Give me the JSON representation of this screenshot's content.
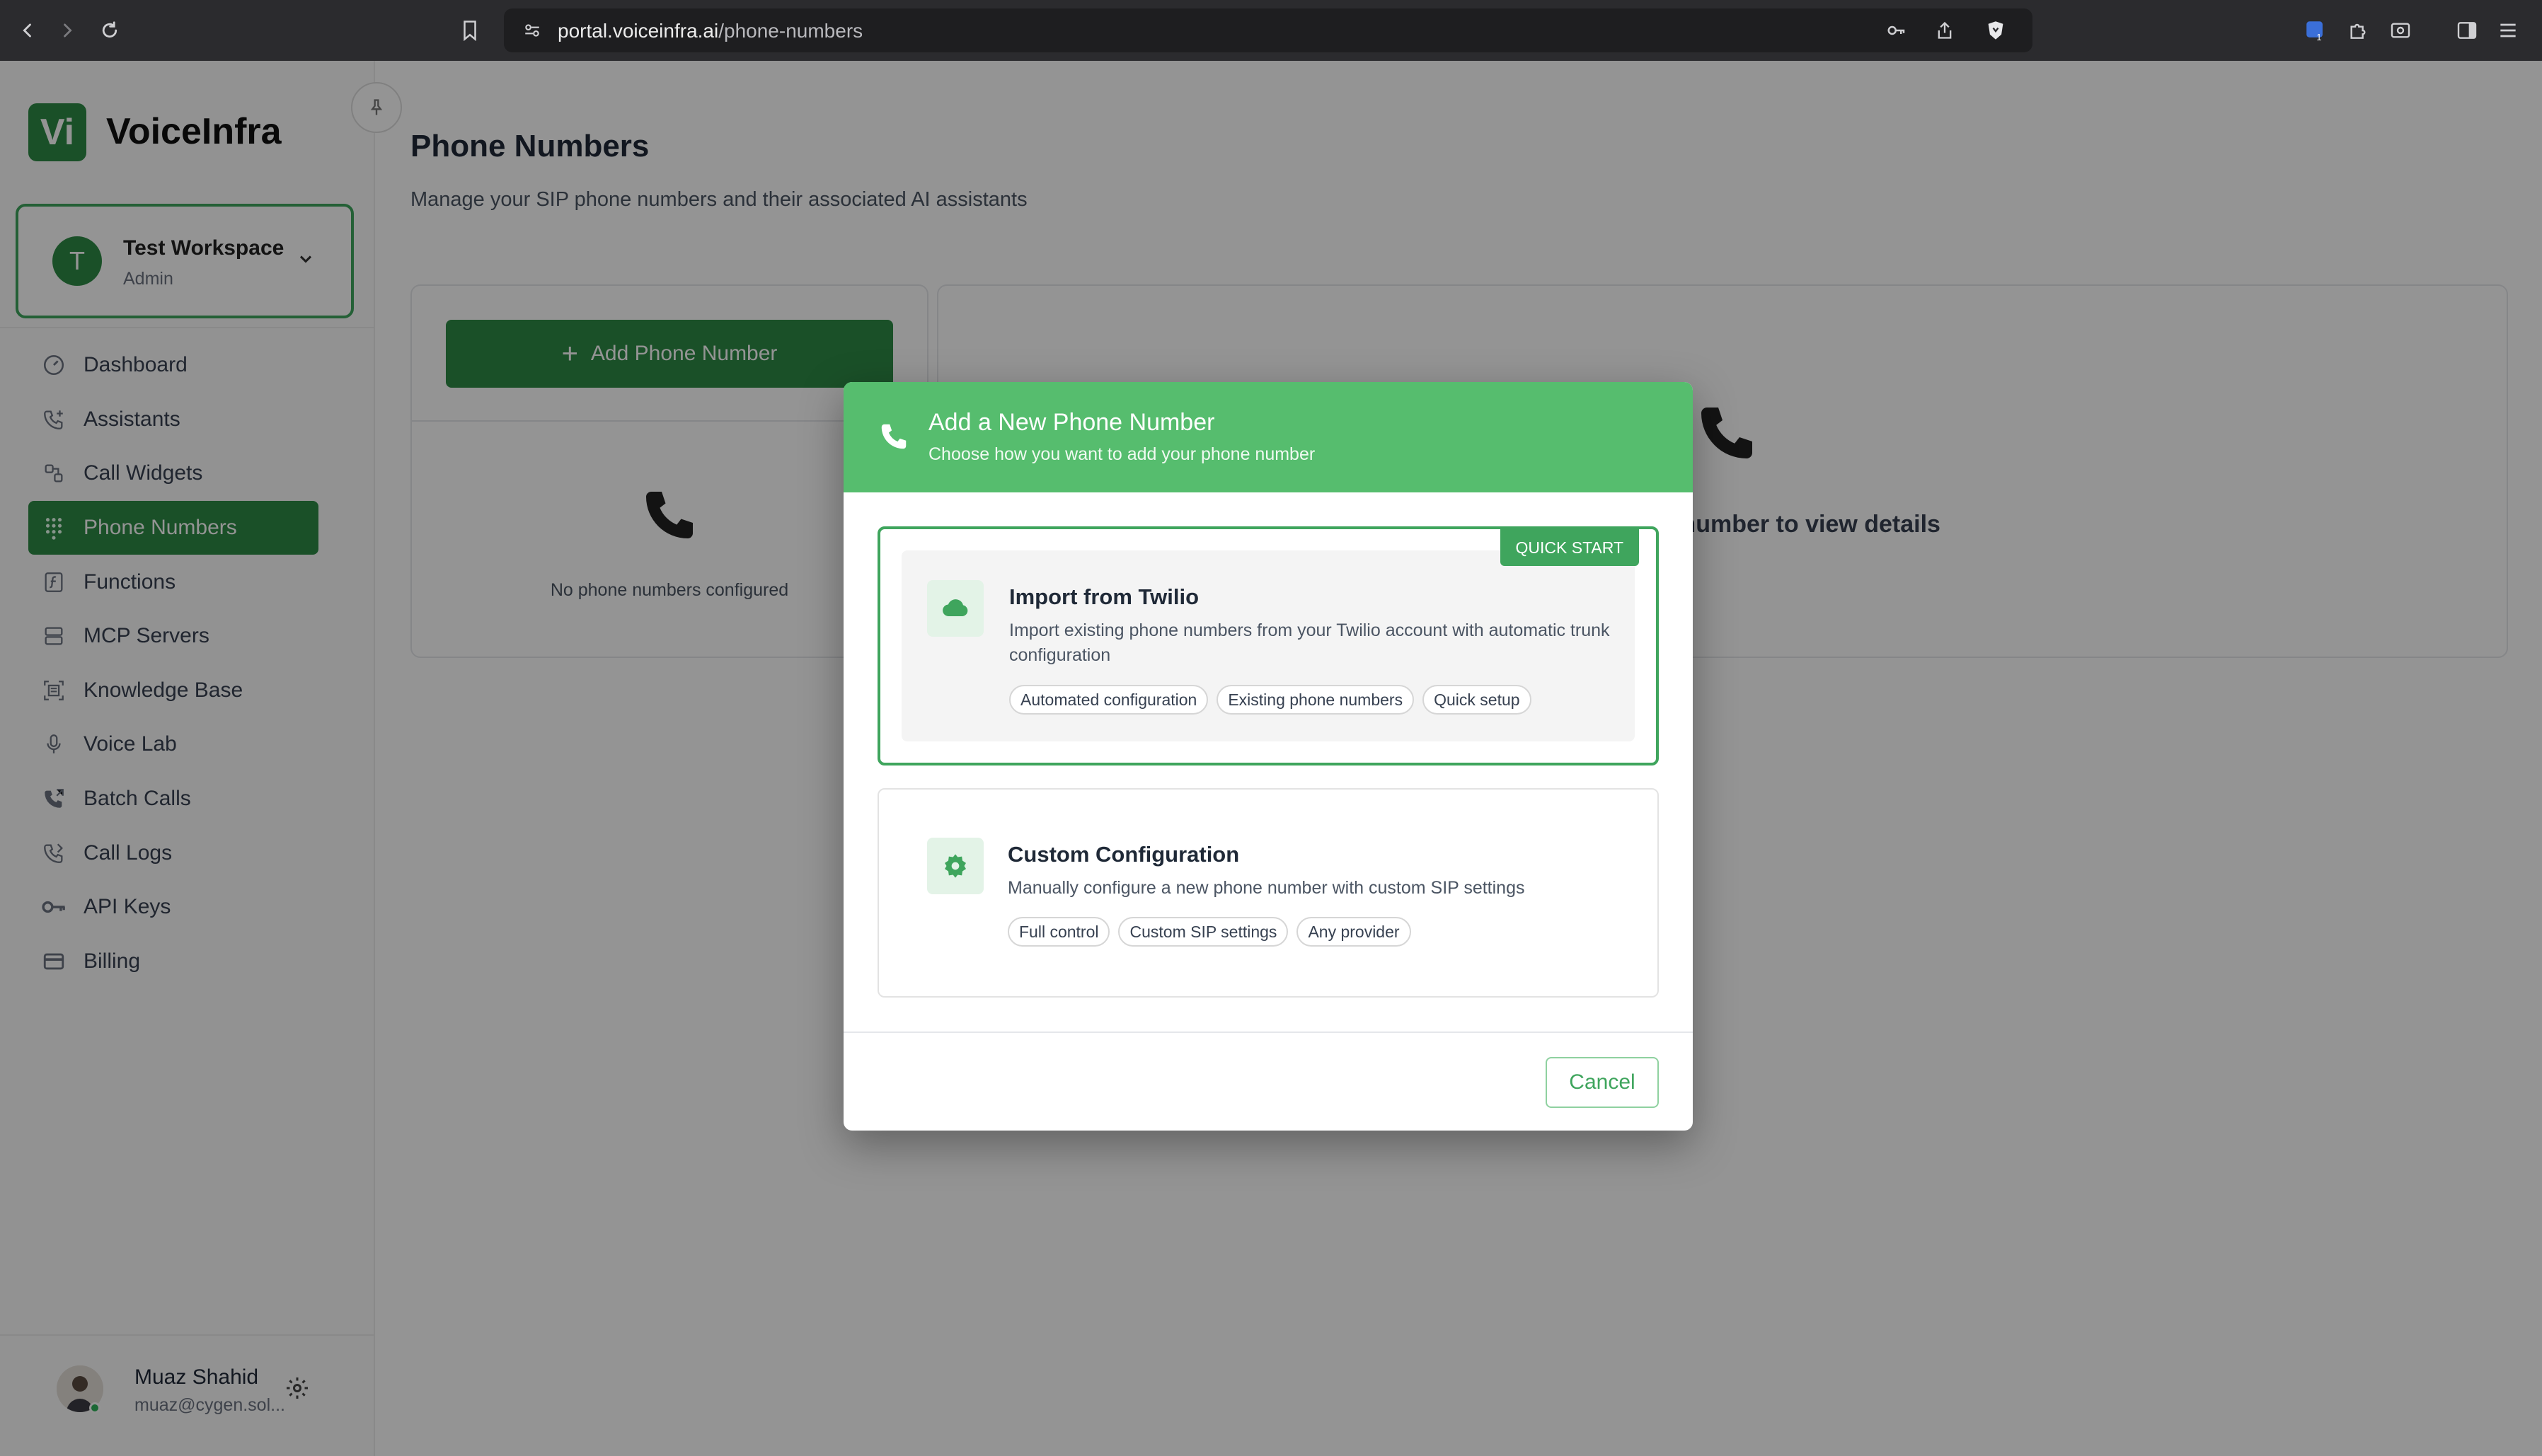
{
  "browser": {
    "url_host": "portal.voiceinfra.ai",
    "url_path": "/phone-numbers",
    "icons": [
      "back-icon",
      "forward-icon",
      "reload-icon",
      "bookmark-icon",
      "site-settings-icon",
      "key-icon",
      "share-icon",
      "brave-shield-icon",
      "extension-icon",
      "puzzle-icon",
      "screenshot-icon",
      "sidebar-icon",
      "menu-icon"
    ]
  },
  "brand": {
    "logo_letters": "Vi",
    "name": "VoiceInfra",
    "accent": "#2e8b45",
    "accent_light": "#56bd6e"
  },
  "workspace": {
    "initial": "T",
    "name": "Test Workspace",
    "role": "Admin"
  },
  "sidebar": {
    "items": [
      {
        "label": "Dashboard",
        "icon": "dashboard-icon"
      },
      {
        "label": "Assistants",
        "icon": "phone-plus-icon"
      },
      {
        "label": "Call Widgets",
        "icon": "widget-icon"
      },
      {
        "label": "Phone Numbers",
        "icon": "keypad-icon",
        "active": true
      },
      {
        "label": "Functions",
        "icon": "function-icon"
      },
      {
        "label": "MCP Servers",
        "icon": "server-icon"
      },
      {
        "label": "Knowledge Base",
        "icon": "knowledge-icon"
      },
      {
        "label": "Voice Lab",
        "icon": "microphone-icon"
      },
      {
        "label": "Batch Calls",
        "icon": "batch-call-icon"
      },
      {
        "label": "Call Logs",
        "icon": "call-log-icon"
      },
      {
        "label": "API Keys",
        "icon": "key-icon"
      },
      {
        "label": "Billing",
        "icon": "card-icon"
      }
    ]
  },
  "user": {
    "name": "Muaz Shahid",
    "email": "muaz@cygen.sol..."
  },
  "main": {
    "title": "Phone Numbers",
    "subtitle": "Manage your SIP phone numbers and their associated AI assistants",
    "add_button": "Add Phone Number",
    "empty_text": "No phone numbers configured",
    "detail_text": "Select a phone number to view details"
  },
  "modal": {
    "title": "Add a New Phone Number",
    "subtitle": "Choose how you want to add your phone number",
    "options": [
      {
        "badge": "QUICK START",
        "title": "Import from Twilio",
        "description": "Import existing phone numbers from your Twilio account with automatic trunk configuration",
        "icon": "cloud-icon",
        "chips": [
          "Automated configuration",
          "Existing phone numbers",
          "Quick setup"
        ],
        "selected": true
      },
      {
        "title": "Custom Configuration",
        "description": "Manually configure a new phone number with custom SIP settings",
        "icon": "gear-icon",
        "chips": [
          "Full control",
          "Custom SIP settings",
          "Any provider"
        ],
        "selected": false
      }
    ],
    "cancel": "Cancel"
  }
}
